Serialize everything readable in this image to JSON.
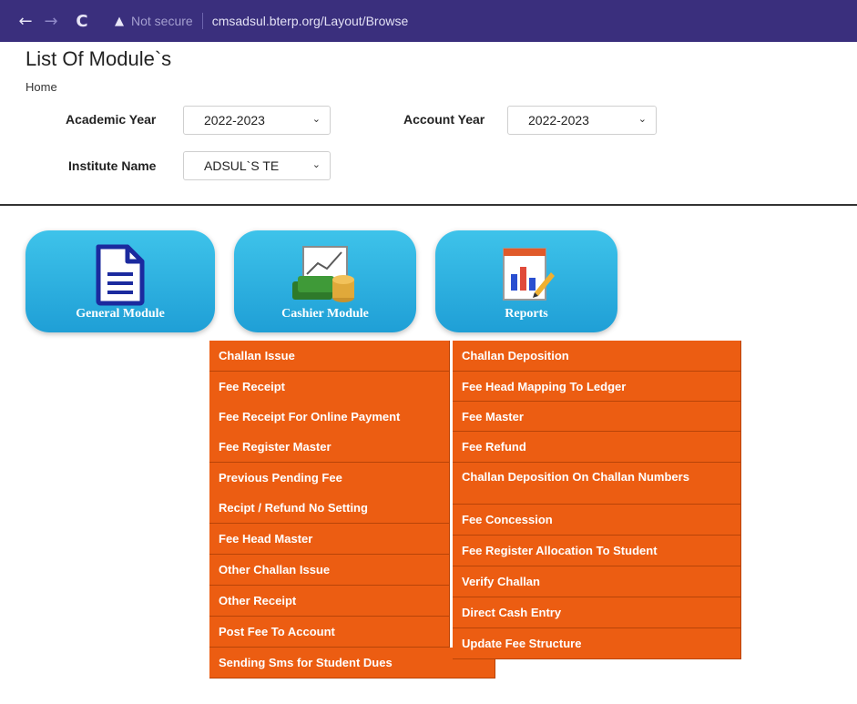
{
  "browser": {
    "back_icon": "←",
    "forward_icon": "→",
    "reload_icon": "C",
    "warning_icon": "▲",
    "security_text": "Not secure",
    "url": "cmsadsul.bterp.org/Layout/Browse"
  },
  "page": {
    "title": "List Of Module`s",
    "breadcrumb": "Home"
  },
  "filters": {
    "academic_year": {
      "label": "Academic Year",
      "value": "2022-2023"
    },
    "account_year": {
      "label": "Account Year",
      "value": "2022-2023"
    },
    "institute_name": {
      "label": "Institute Name",
      "value": "ADSUL`S TE"
    },
    "chevron_icon": "⌄"
  },
  "modules": [
    {
      "label": "General Module",
      "icon": "document-icon"
    },
    {
      "label": "Cashier Module",
      "icon": "cash-chart-icon"
    },
    {
      "label": "Reports",
      "icon": "report-chart-icon"
    }
  ],
  "cashier_menu": {
    "left": [
      "Challan Issue",
      "Fee Receipt",
      "Fee Receipt For Online Payment",
      "Fee Register Master",
      "Previous Pending Fee",
      "Recipt / Refund No Setting",
      "Fee Head Master",
      "Other Challan Issue",
      "Other Receipt",
      "Post Fee To Account",
      "Sending Sms for Student Dues"
    ],
    "right": [
      "Challan Deposition",
      "Fee Head Mapping To Ledger",
      "Fee Master",
      "Fee Refund",
      "Challan Deposition On Challan Numbers",
      "Fee Concession",
      "Fee Register Allocation To Student",
      "Verify Challan",
      "Direct Cash Entry",
      "Update Fee Structure"
    ]
  },
  "colors": {
    "browser_bar": "#3a2f7d",
    "tile": "#2bb0e0",
    "menu": "#ec5d12"
  }
}
